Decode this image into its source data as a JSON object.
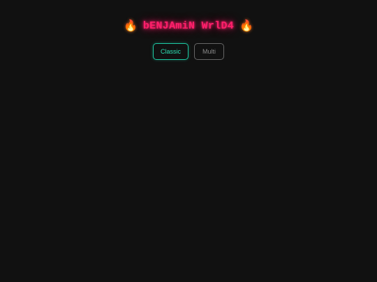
{
  "header": {
    "title": "bENJAmiN WrlD4",
    "left_icon": "fire-icon",
    "right_icon": "fire-icon",
    "flame_glyph": "🔥",
    "title_color": "#ff1f6b"
  },
  "modes": {
    "selected": "Classic",
    "items": [
      {
        "label": "Classic",
        "active": true
      },
      {
        "label": "Multi",
        "active": false
      }
    ],
    "active_color": "#1ec9a3",
    "inactive_color": "#666666"
  },
  "background_color": "#111111"
}
